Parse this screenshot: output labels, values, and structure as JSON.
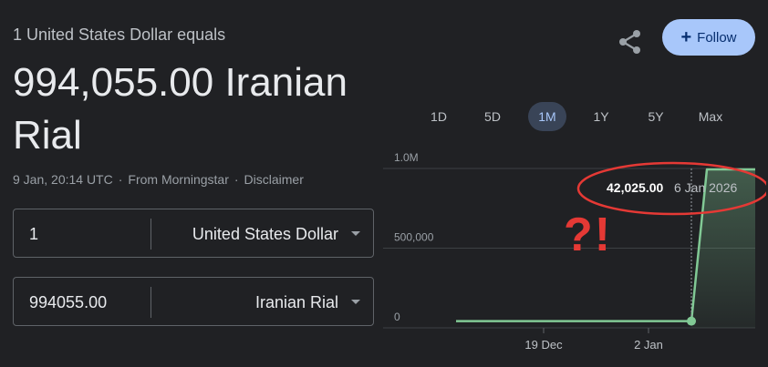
{
  "header": {
    "subtitle": "1 United States Dollar equals",
    "amount_line": "994,055.00 Iranian Rial"
  },
  "meta": {
    "timestamp": "9 Jan, 20:14 UTC",
    "source": "From Morningstar",
    "disclaimer": "Disclaimer"
  },
  "converter": {
    "from_value": "1",
    "from_currency": "United States Dollar",
    "to_value": "994055.00",
    "to_currency": "Iranian Rial"
  },
  "actions": {
    "share_icon": "share-icon",
    "follow_label": "Follow",
    "follow_color": "#a8c7fa"
  },
  "range_tabs": [
    "1D",
    "5D",
    "1M",
    "1Y",
    "5Y",
    "Max"
  ],
  "active_tab": "1M",
  "chart_data": {
    "type": "area",
    "y_tick_labels": [
      "1.0M",
      "500,000",
      "0"
    ],
    "x_tick_labels": [
      "19 Dec",
      "2 Jan"
    ],
    "ylim": [
      0,
      1000000
    ],
    "x": [
      "10 Dec",
      "6 Jan 2026",
      "7 Jan",
      "9 Jan"
    ],
    "values": [
      42025,
      42025,
      994055,
      994055
    ],
    "line_color": "#81c995",
    "tooltip": {
      "value": "42,025.00",
      "date": "6 Jan 2026"
    }
  },
  "annotation": {
    "text": "?!",
    "color": "#e53935"
  }
}
